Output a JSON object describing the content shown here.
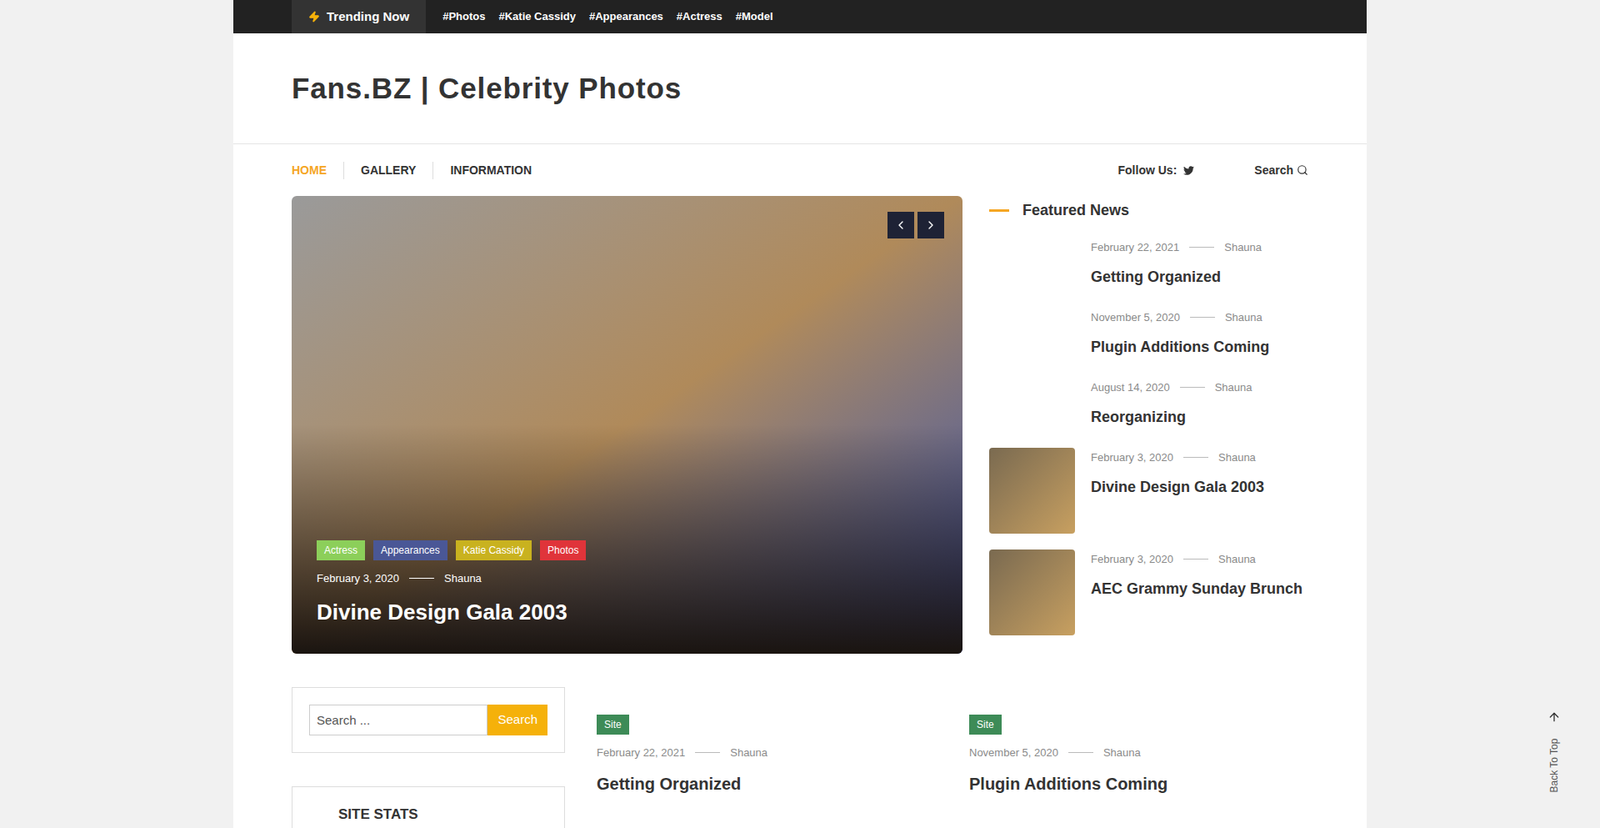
{
  "topbar": {
    "label": "Trending Now",
    "tags": [
      "#Photos",
      "#Katie Cassidy",
      "#Appearances",
      "#Actress",
      "#Model"
    ]
  },
  "site_title": "Fans.BZ | Celebrity Photos",
  "nav": {
    "items": [
      {
        "label": "HOME",
        "selected": true
      },
      {
        "label": "GALLERY",
        "selected": false
      },
      {
        "label": "INFORMATION",
        "selected": false
      }
    ],
    "follow": "Follow Us:",
    "search": "Search"
  },
  "slider": {
    "tags": [
      {
        "label": "Actress",
        "color": "#8ccf5a"
      },
      {
        "label": "Appearances",
        "color": "#4a5796"
      },
      {
        "label": "Katie Cassidy",
        "color": "#c9b21f"
      },
      {
        "label": "Photos",
        "color": "#e0343a"
      }
    ],
    "date": "February 3, 2020",
    "author": "Shauna",
    "title": "Divine Design Gala 2003"
  },
  "featured": {
    "heading": "Featured News",
    "items": [
      {
        "date": "February 22, 2021",
        "author": "Shauna",
        "title": "Getting Organized",
        "image": false
      },
      {
        "date": "November 5, 2020",
        "author": "Shauna",
        "title": "Plugin Additions Coming",
        "image": false
      },
      {
        "date": "August 14, 2020",
        "author": "Shauna",
        "title": "Reorganizing",
        "image": false
      },
      {
        "date": "February 3, 2020",
        "author": "Shauna",
        "title": "Divine Design Gala 2003",
        "image": true
      },
      {
        "date": "February 3, 2020",
        "author": "Shauna",
        "title": "AEC Grammy Sunday Brunch",
        "image": true
      }
    ]
  },
  "sidebar": {
    "search_placeholder": "Search ...",
    "search_button": "Search",
    "widget_title": "SITE STATS"
  },
  "posts": [
    {
      "category": "Site",
      "date": "February 22, 2021",
      "author": "Shauna",
      "title": "Getting Organized"
    },
    {
      "category": "Site",
      "date": "November 5, 2020",
      "author": "Shauna",
      "title": "Plugin Additions Coming"
    }
  ],
  "back_to_top": "Back To Top"
}
